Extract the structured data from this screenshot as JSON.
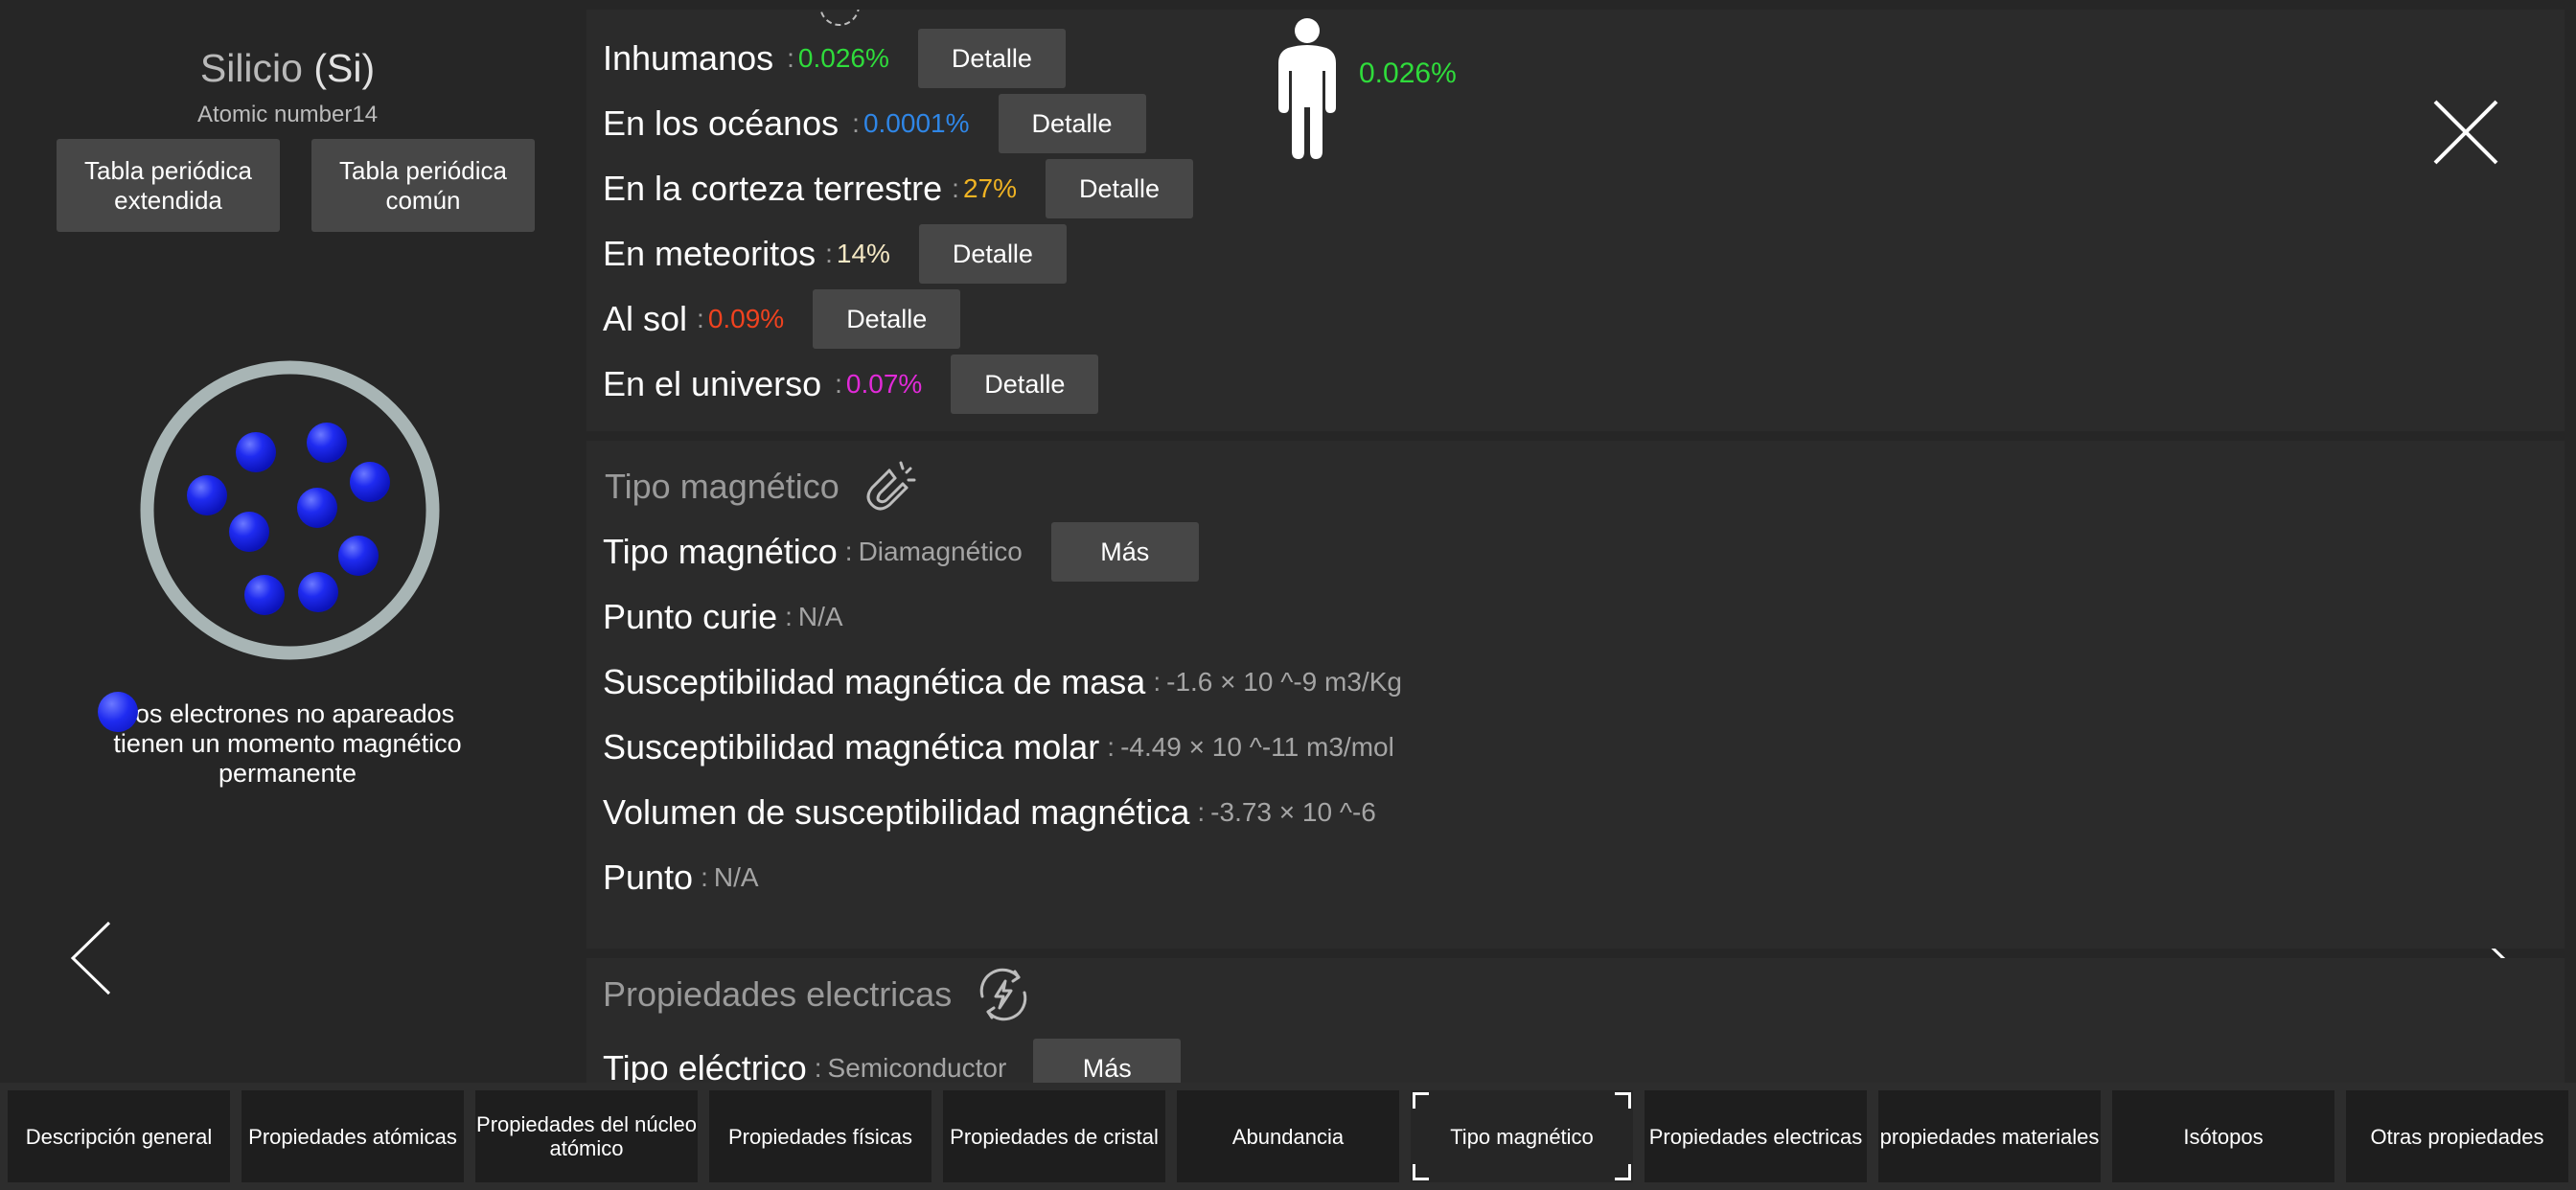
{
  "element": {
    "name": "Silicio",
    "symbol": "(Si)",
    "atomic_label": "Atomic number",
    "atomic_number": "14"
  },
  "left": {
    "btn_extended": "Tabla periódica extendida",
    "btn_common": "Tabla periódica común",
    "legend_text": "Los electrones no apareados tienen un momento magnético permanente"
  },
  "abundance": {
    "rows": [
      {
        "label": "Inhumanos",
        "sep": ":",
        "value": "0.026%",
        "color": "#2fdc3b",
        "button": "Detalle"
      },
      {
        "label": "En los océanos",
        "sep": ":",
        "value": "0.0001%",
        "color": "#2f86e6",
        "button": "Detalle"
      },
      {
        "label": "En la corteza terrestre",
        "sep": ":",
        "value": "27%",
        "color": "#f0b323",
        "button": "Detalle"
      },
      {
        "label": "En meteoritos",
        "sep": ":",
        "value": "14%",
        "color": "#f4e8c4",
        "button": "Detalle"
      },
      {
        "label": "Al sol",
        "sep": ":",
        "value": "0.09%",
        "color": "#f0421f",
        "button": "Detalle"
      },
      {
        "label": "En el universo",
        "sep": ":",
        "value": "0.07%",
        "color": "#e12ad8",
        "button": "Detalle"
      }
    ],
    "human_value": "0.026%"
  },
  "magnetic": {
    "title": "Tipo magnético",
    "rows": [
      {
        "label": "Tipo magnético",
        "sep": ":",
        "value": "Diamagnético",
        "button": "Más"
      },
      {
        "label": "Punto curie",
        "sep": ":",
        "value": "N/A"
      },
      {
        "label": "Susceptibilidad magnética de masa",
        "sep": ":",
        "value": "-1.6 × 10 ^-9 m3/Kg"
      },
      {
        "label": "Susceptibilidad magnética molar",
        "sep": ":",
        "value": "-4.49 × 10 ^-11 m3/mol"
      },
      {
        "label": "Volumen de susceptibilidad magnética",
        "sep": ":",
        "value": "-3.73 × 10 ^-6"
      },
      {
        "label": "Punto",
        "sep": ":",
        "value": "N/A"
      }
    ]
  },
  "electric": {
    "title": "Propiedades electricas",
    "row": {
      "label": "Tipo eléctrico",
      "sep": ":",
      "value": "Semiconductor",
      "button": "Más"
    }
  },
  "tabs": [
    {
      "label": "Descripción general"
    },
    {
      "label": "Propiedades atómicas"
    },
    {
      "label": "Propiedades del núcleo atómico"
    },
    {
      "label": "Propiedades físicas"
    },
    {
      "label": "Propiedades de cristal"
    },
    {
      "label": "Abundancia"
    },
    {
      "label": "Tipo magnético",
      "active": true
    },
    {
      "label": "Propiedades electricas"
    },
    {
      "label": "propiedades materiales"
    },
    {
      "label": "Isótopos"
    },
    {
      "label": "Otras propiedades"
    }
  ],
  "colors": {
    "electron": "#1f2bf0",
    "shell": "#a8b5b5",
    "background": "#262626"
  },
  "icons": {
    "close": "close-icon",
    "prev": "chevron-left-icon",
    "next": "chevron-right-icon",
    "magnet": "magnet-icon",
    "electric": "electric-cycle-icon",
    "human": "human-figure-icon"
  }
}
